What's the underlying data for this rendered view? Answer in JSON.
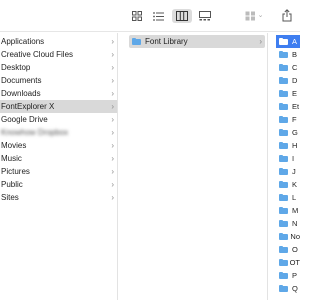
{
  "toolbar": {
    "icons": [
      "icon-view-icon",
      "list-view-icon",
      "column-view-icon",
      "gallery-view-icon",
      "group-icon",
      "share-icon"
    ],
    "chevron": "⌄"
  },
  "sidebar": {
    "items": [
      {
        "label": "Applications"
      },
      {
        "label": "Creative Cloud Files"
      },
      {
        "label": "Desktop"
      },
      {
        "label": "Documents"
      },
      {
        "label": "Downloads"
      },
      {
        "label": "FontExplorer X",
        "state": "selected"
      },
      {
        "label": "Google Drive"
      },
      {
        "label": "Knowhow Dropbox",
        "blurred": true
      },
      {
        "label": "Movies"
      },
      {
        "label": "Music"
      },
      {
        "label": "Pictures"
      },
      {
        "label": "Public"
      },
      {
        "label": "Sites"
      }
    ],
    "chevron": "›"
  },
  "column2": {
    "items": [
      {
        "label": "Font Library"
      }
    ],
    "chevron": "›"
  },
  "column3": {
    "items": [
      "A",
      "B",
      "C",
      "D",
      "E",
      "Et",
      "F",
      "G",
      "H",
      "I",
      "J",
      "K",
      "L",
      "M",
      "N",
      "No",
      "O",
      "OT",
      "P",
      "Q"
    ]
  },
  "colors": {
    "selection_blue": "#3f7ef0",
    "selection_gray": "#d9d9d9",
    "folder_blue": "#5fa8e8"
  }
}
